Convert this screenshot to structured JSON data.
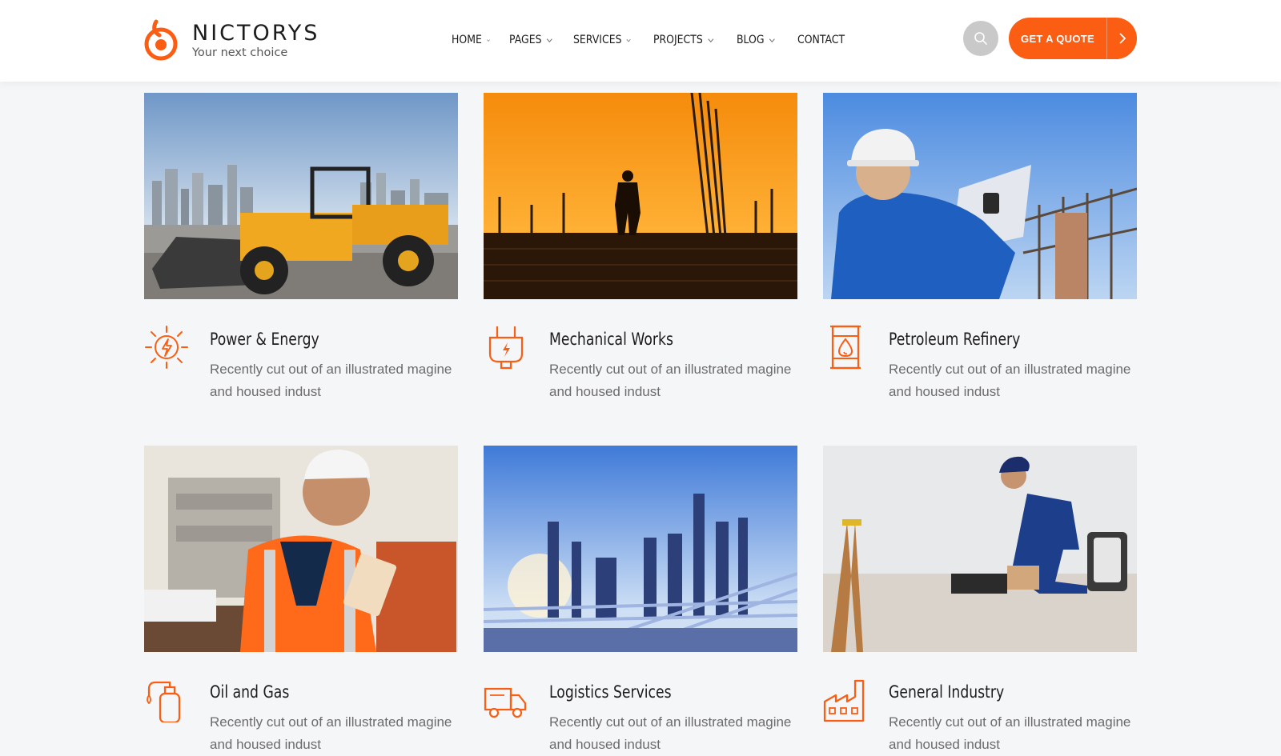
{
  "brand": {
    "name": "NICTORYS",
    "tagline": "Your next choice",
    "accent": "#fb5d13"
  },
  "nav": {
    "items": [
      {
        "label": "HOME",
        "has_dropdown": true
      },
      {
        "label": "PAGES",
        "has_dropdown": true
      },
      {
        "label": "SERVICES",
        "has_dropdown": true
      },
      {
        "label": "PROJECTS",
        "has_dropdown": true
      },
      {
        "label": "BLOG",
        "has_dropdown": true
      },
      {
        "label": "CONTACT",
        "has_dropdown": false
      }
    ]
  },
  "header": {
    "search_icon": "search-icon",
    "cta_label": "GET A QUOTE",
    "cta_icon": "chevron-right-icon"
  },
  "services": [
    {
      "title": "Power & Energy",
      "desc": "Recently cut out of an illustrated magine and housed indust",
      "icon": "power-energy-icon",
      "image": "wheel-loader-photo"
    },
    {
      "title": "Mechanical Works",
      "desc": "Recently cut out of an illustrated magine and housed indust",
      "icon": "electric-plug-icon",
      "image": "sunset-worker-photo"
    },
    {
      "title": "Petroleum Refinery",
      "desc": "Recently cut out of an illustrated magine and housed indust",
      "icon": "oil-barrel-icon",
      "image": "engineer-blueprint-photo"
    },
    {
      "title": "Oil and Gas",
      "desc": "Recently cut out of an illustrated magine and housed indust",
      "icon": "gas-cylinder-icon",
      "image": "worker-tablet-photo"
    },
    {
      "title": "Logistics Services",
      "desc": "Recently cut out of an illustrated magine and housed indust",
      "icon": "delivery-truck-icon",
      "image": "refinery-plant-photo"
    },
    {
      "title": "General Industry",
      "desc": "Recently cut out of an illustrated magine and housed indust",
      "icon": "factory-icon",
      "image": "floor-worker-photo"
    }
  ]
}
